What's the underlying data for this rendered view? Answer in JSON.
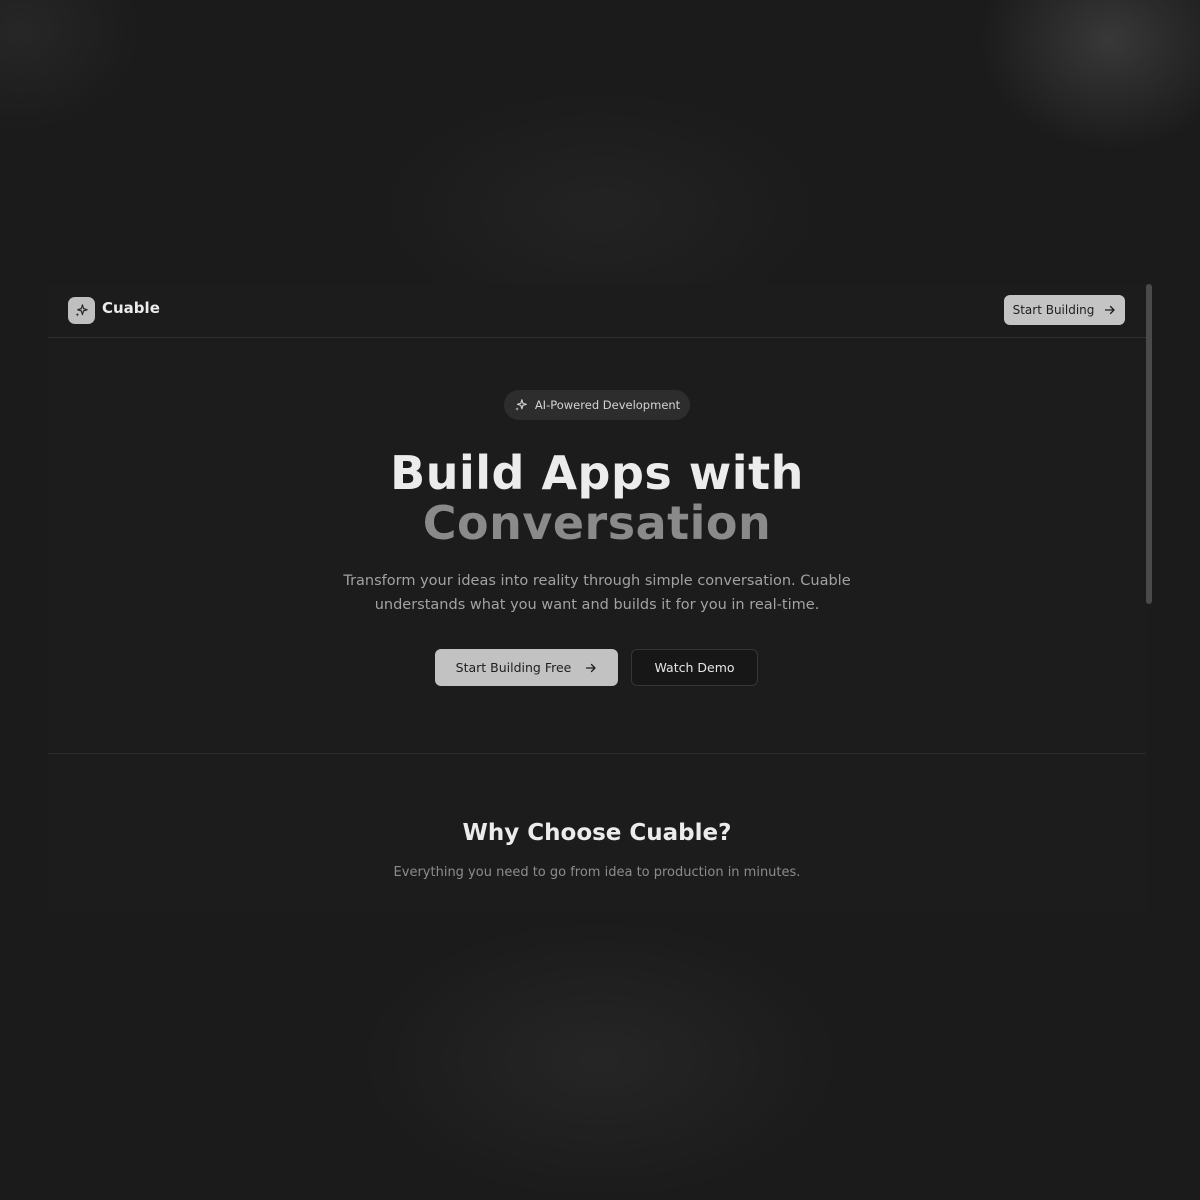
{
  "nav": {
    "brand": "Cuable",
    "logo_icon": "sparkle-icon",
    "cta_label": "Start Building",
    "cta_icon": "arrow-right-icon"
  },
  "hero": {
    "badge_icon": "sparkle-icon",
    "badge_label": "AI-Powered Development",
    "title_line1": "Build Apps with",
    "title_line2": "Conversation",
    "subtitle": "Transform your ideas into reality through simple conversation. Cuable understands what you want and builds it for you in real-time.",
    "primary_button": "Start Building Free",
    "primary_icon": "arrow-right-icon",
    "secondary_button": "Watch Demo"
  },
  "features": {
    "title": "Why Choose Cuable?",
    "subtitle": "Everything you need to go from idea to production in minutes."
  },
  "colors": {
    "background": "#1b1b1b",
    "text_primary": "#ececec",
    "text_muted": "#8a8a8a",
    "button_light": "#c2c2c2"
  }
}
